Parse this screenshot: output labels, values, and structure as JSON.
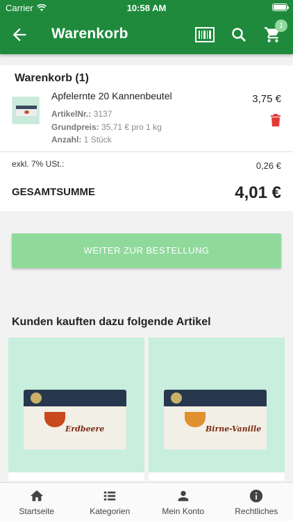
{
  "status_bar": {
    "carrier": "Carrier",
    "time": "10:58 AM"
  },
  "app_bar": {
    "title": "Warenkorb",
    "cart_count": "1"
  },
  "cart": {
    "heading": "Warenkorb (1)",
    "item": {
      "name": "Apfelernte 20 Kannenbeutel",
      "article_label": "ArtikelNr.:",
      "article_value": "3137",
      "base_price_label": "Grundpreis:",
      "base_price_value": "35,71 € pro 1 kg",
      "quantity_label": "Anzahl:",
      "quantity_value": "1 Stück",
      "price": "3,75 €"
    },
    "tax_label": "exkl. 7% USt.:",
    "tax_value": "0,26 €",
    "total_label": "GESAMTSUMME",
    "total_value": "4,01 €"
  },
  "checkout_button": "WEITER ZUR BESTELLUNG",
  "recommendations": {
    "heading": "Kunden kauften dazu folgende Artikel",
    "products": [
      {
        "flavor": "Erdbeere"
      },
      {
        "flavor": "Birne-Vanille"
      }
    ]
  },
  "tab_bar": [
    {
      "label": "Startseite",
      "icon": "home-icon"
    },
    {
      "label": "Kategorien",
      "icon": "list-icon"
    },
    {
      "label": "Mein Konto",
      "icon": "person-icon"
    },
    {
      "label": "Rechtliches",
      "icon": "info-icon"
    }
  ],
  "colors": {
    "primary": "#1f8a3c",
    "accent_light": "#8fd99b",
    "product_bg": "#c8eedd",
    "delete": "#e53935"
  }
}
